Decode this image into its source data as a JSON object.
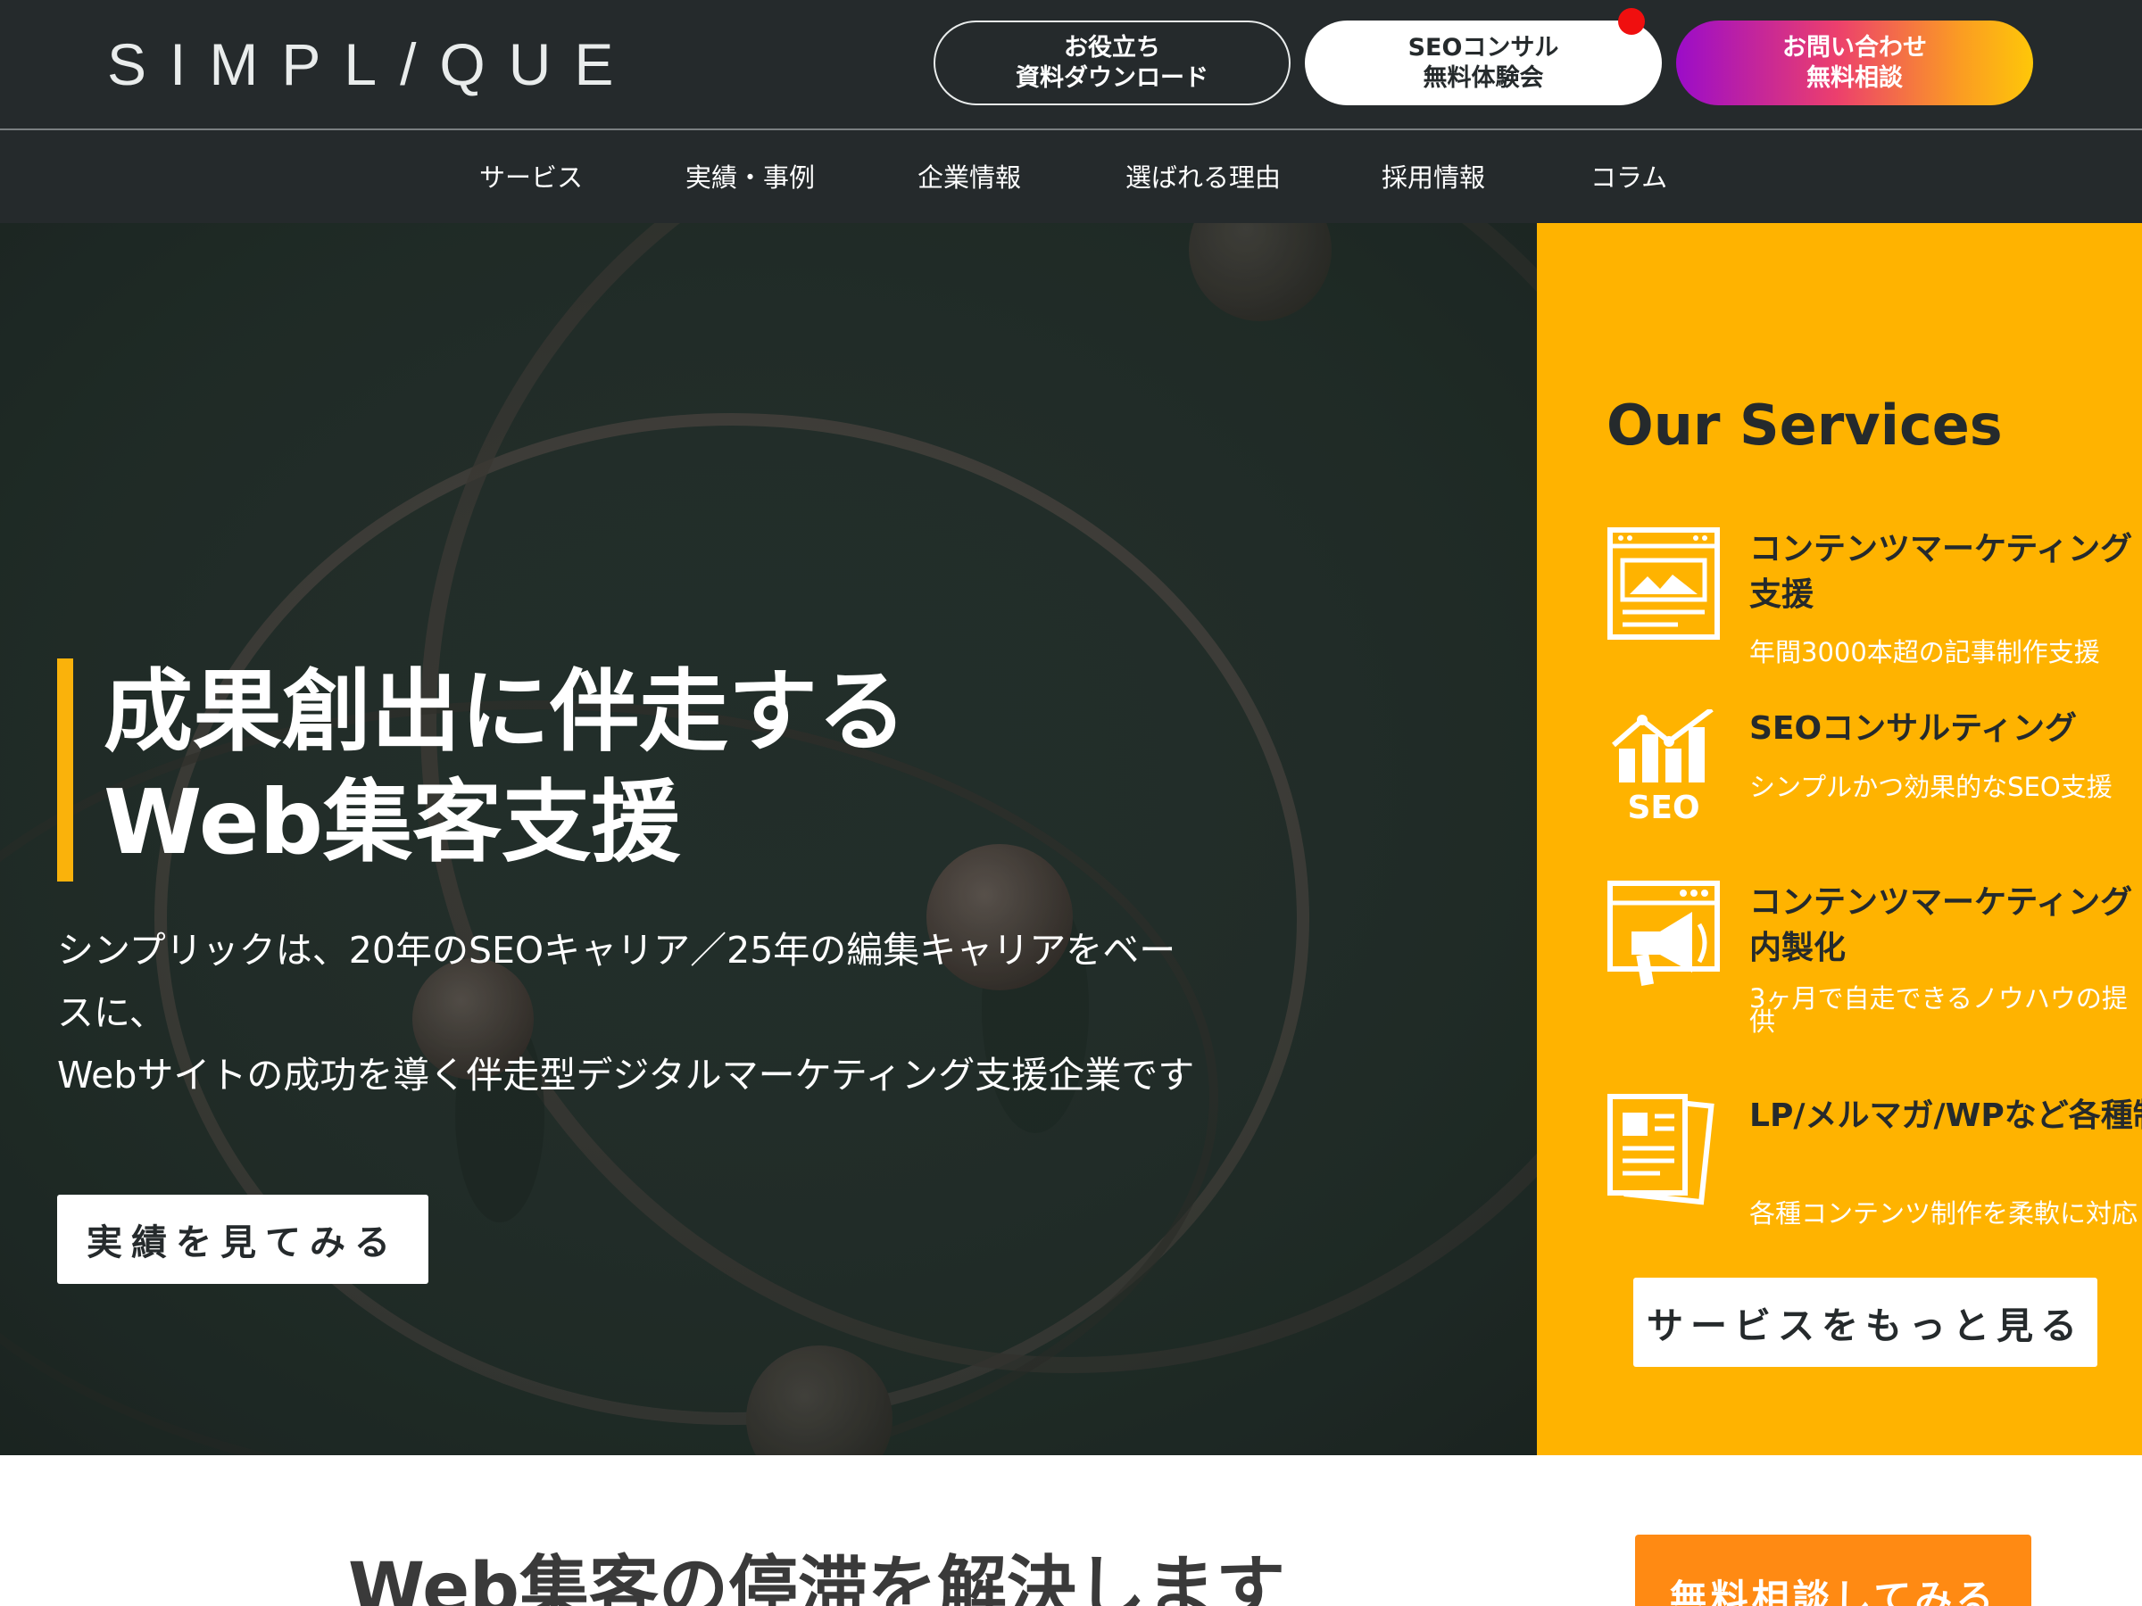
{
  "header": {
    "logo": "SIMPL/QUE",
    "download_line1": "お役立ち",
    "download_line2": "資料ダウンロード",
    "seo_line1": "SEOコンサル",
    "seo_line2": "無料体験会",
    "contact_line1": "お問い合わせ",
    "contact_line2": "無料相談"
  },
  "nav": {
    "items": [
      "サービス",
      "実績・事例",
      "企業情報",
      "選ばれる理由",
      "採用情報",
      "コラム"
    ]
  },
  "hero": {
    "title_line1": "成果創出に伴走する",
    "title_line2": "Web集客支援",
    "desc_line1": "シンプリックは、20年のSEOキャリア／25年の編集キャリアをベー",
    "desc_line2": "スに、",
    "desc_line3": "Webサイトの成功を導く伴走型デジタルマーケティング支援企業です",
    "cta": "実績を見てみる"
  },
  "services": {
    "heading": "Our Services",
    "items": [
      {
        "icon": "browser-image-icon",
        "title": "コンテンツマーケティング支援",
        "sub": "年間3000本超の記事制作支援"
      },
      {
        "icon": "seo-chart-icon",
        "title": "SEOコンサルティング",
        "sub": "シンプルかつ効果的なSEO支援"
      },
      {
        "icon": "megaphone-icon",
        "title": "コンテンツマーケティング内製化",
        "sub": "3ヶ月で自走できるノウハウの提供"
      },
      {
        "icon": "documents-icon",
        "title": "LP/メルマガ/WPなど各種制作",
        "sub": "各種コンテンツ制作を柔軟に対応"
      }
    ],
    "seo_icon_label": "SEO",
    "more": "サービスをもっと見る"
  },
  "section": {
    "title": "Web集客の停滞を解決します",
    "consult": "無料相談してみる"
  },
  "colors": {
    "header_bg": "#252a2c",
    "hero_bg": "#26332e",
    "accent_yellow": "#ffb300",
    "consult_orange": "#ff8a13",
    "notification_red": "#f00f0f"
  }
}
